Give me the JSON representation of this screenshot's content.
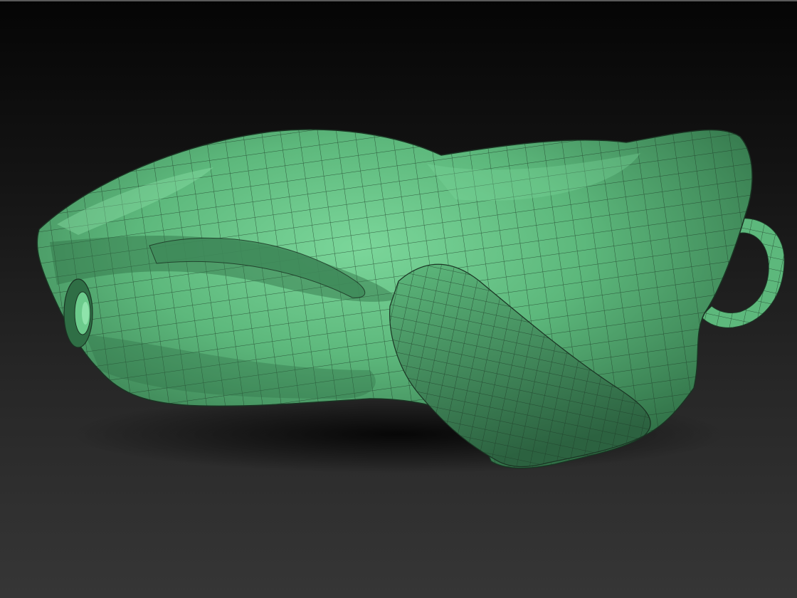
{
  "viewport": {
    "background_top": "#050505",
    "background_bottom": "#363636",
    "mesh_color": "#5db87c",
    "mesh_highlight": "#7bd69a",
    "mesh_shadow": "#2f6e45",
    "wire_color": "#1d3a27"
  }
}
